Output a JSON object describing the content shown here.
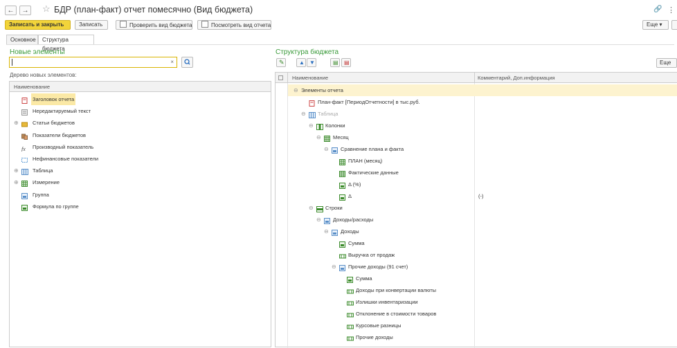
{
  "window": {
    "title": "БДР (план-факт) отчет помесячно (Вид бюджета)"
  },
  "toolbar": {
    "save_close": "Записать и закрыть",
    "save": "Записать",
    "check": "Проверить вид бюджета",
    "view_report": "Посмотреть вид отчета",
    "more": "Еще ▾",
    "help": "?"
  },
  "tabs": [
    "Основное",
    "Структура бюджета"
  ],
  "left": {
    "title": "Новые элементы",
    "search_value": "",
    "tree_label": "Дерево новых элементов:",
    "column": "Наименование",
    "items": [
      {
        "label": "Заголовок отчета",
        "icon": "report-title-icon",
        "expandable": false,
        "selected": true
      },
      {
        "label": "Нередактируемый текст",
        "icon": "text-icon",
        "expandable": false
      },
      {
        "label": "Статьи бюджетов",
        "icon": "folder-icon",
        "expandable": true
      },
      {
        "label": "Показатели бюджетов",
        "icon": "indicator-icon",
        "expandable": false
      },
      {
        "label": "Производный показатель",
        "icon": "fx-icon",
        "expandable": false
      },
      {
        "label": "Нефинансовые показатели",
        "icon": "nonfin-icon",
        "expandable": false
      },
      {
        "label": "Таблица",
        "icon": "table-icon",
        "expandable": true
      },
      {
        "label": "Измерение",
        "icon": "dimension-icon",
        "expandable": true
      },
      {
        "label": "Группа",
        "icon": "group-icon",
        "expandable": false
      },
      {
        "label": "Формула по группе",
        "icon": "group-formula-icon",
        "expandable": false
      }
    ]
  },
  "right": {
    "title": "Структура бюджета",
    "more": "Еще",
    "columns": [
      "Наименование",
      "Комментарий, Доп.информация"
    ],
    "rows": [
      {
        "label": "Элементы отчета",
        "level": 0,
        "exp": "⊖",
        "icon": "none",
        "comment": "",
        "selected": true
      },
      {
        "label": "План-факт [ПериодОтчетности] в тыс.руб.",
        "level": 1,
        "exp": "",
        "icon": "report-title-icon",
        "comment": ""
      },
      {
        "label": "Таблица",
        "level": 1,
        "exp": "⊖",
        "icon": "table-icon",
        "comment": "",
        "muted": true
      },
      {
        "label": "Колонки",
        "level": 2,
        "exp": "⊖",
        "icon": "columns-icon",
        "comment": ""
      },
      {
        "label": "Месяц",
        "level": 3,
        "exp": "⊖",
        "icon": "dimension-icon",
        "comment": ""
      },
      {
        "label": "Сравнение плана и факта",
        "level": 4,
        "exp": "⊖",
        "icon": "group-icon",
        "comment": ""
      },
      {
        "label": "ПЛАН (месяц)",
        "level": 5,
        "exp": "",
        "icon": "dimension-icon",
        "comment": ""
      },
      {
        "label": "Фактические данные",
        "level": 5,
        "exp": "",
        "icon": "dimension-icon",
        "comment": ""
      },
      {
        "label": "Δ (%)",
        "level": 5,
        "exp": "",
        "icon": "group-formula-icon",
        "comment": ""
      },
      {
        "label": "Δ",
        "level": 5,
        "exp": "",
        "icon": "group-formula-icon",
        "comment": "(-)"
      },
      {
        "label": "Строки",
        "level": 2,
        "exp": "⊖",
        "icon": "rows-icon",
        "comment": ""
      },
      {
        "label": "Доходы/расходы",
        "level": 3,
        "exp": "⊖",
        "icon": "group-icon",
        "comment": ""
      },
      {
        "label": "Доходы",
        "level": 4,
        "exp": "⊖",
        "icon": "group-icon",
        "comment": ""
      },
      {
        "label": "Сумма",
        "level": 5,
        "exp": "",
        "icon": "group-formula-icon",
        "comment": ""
      },
      {
        "label": "Выручка от продаж",
        "level": 5,
        "exp": "",
        "icon": "article-icon",
        "comment": ""
      },
      {
        "label": "Прочие доходы (91 счет)",
        "level": 5,
        "exp": "⊖",
        "icon": "group-icon",
        "comment": ""
      },
      {
        "label": "Сумма",
        "level": 6,
        "exp": "",
        "icon": "group-formula-icon",
        "comment": ""
      },
      {
        "label": "Доходы при конвертации валюты",
        "level": 6,
        "exp": "",
        "icon": "article-icon",
        "comment": ""
      },
      {
        "label": "Излишки инвентаризации",
        "level": 6,
        "exp": "",
        "icon": "article-icon",
        "comment": ""
      },
      {
        "label": "Отклонение в стоимости товаров",
        "level": 6,
        "exp": "",
        "icon": "article-icon",
        "comment": ""
      },
      {
        "label": "Курсовые разницы",
        "level": 6,
        "exp": "",
        "icon": "article-icon",
        "comment": ""
      },
      {
        "label": "Прочие доходы",
        "level": 6,
        "exp": "",
        "icon": "article-icon",
        "comment": ""
      }
    ]
  },
  "colors": {
    "accent": "#f2d43a",
    "green_title": "#3a9a3a",
    "selection": "#fbe9a6"
  }
}
